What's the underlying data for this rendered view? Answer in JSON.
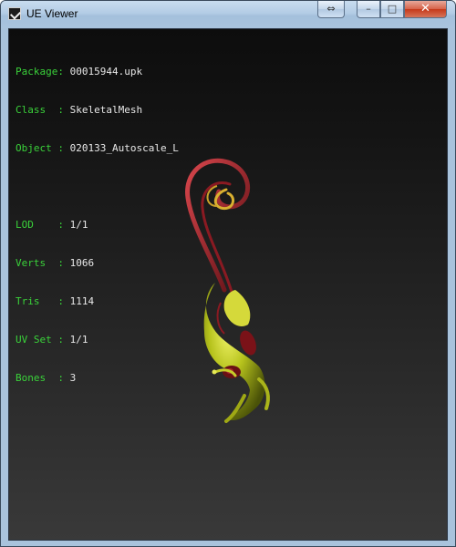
{
  "window": {
    "title": "UE Viewer",
    "icon": "ue-viewer-app-icon",
    "controls": {
      "restore_alt_glyph": "⇔",
      "minimize_glyph": "–",
      "maximize_glyph": "□",
      "close_glyph": "✕"
    }
  },
  "info": {
    "group1": [
      {
        "label": "Package: ",
        "value": "00015944.upk"
      },
      {
        "label": "Class  : ",
        "value": "SkeletalMesh"
      },
      {
        "label": "Object : ",
        "value": "020133_Autoscale_L"
      }
    ],
    "group2": [
      {
        "label": "LOD    : ",
        "value": "1/1"
      },
      {
        "label": "Verts  : ",
        "value": "1066"
      },
      {
        "label": "Tris   : ",
        "value": "1114"
      },
      {
        "label": "UV Set : ",
        "value": "1/1"
      },
      {
        "label": "Bones  : ",
        "value": "3"
      }
    ]
  },
  "colors": {
    "label": "#3ad23a",
    "value": "#e8e8e8",
    "model_red": "#8a1a22",
    "model_yellow": "#b8c21e"
  }
}
